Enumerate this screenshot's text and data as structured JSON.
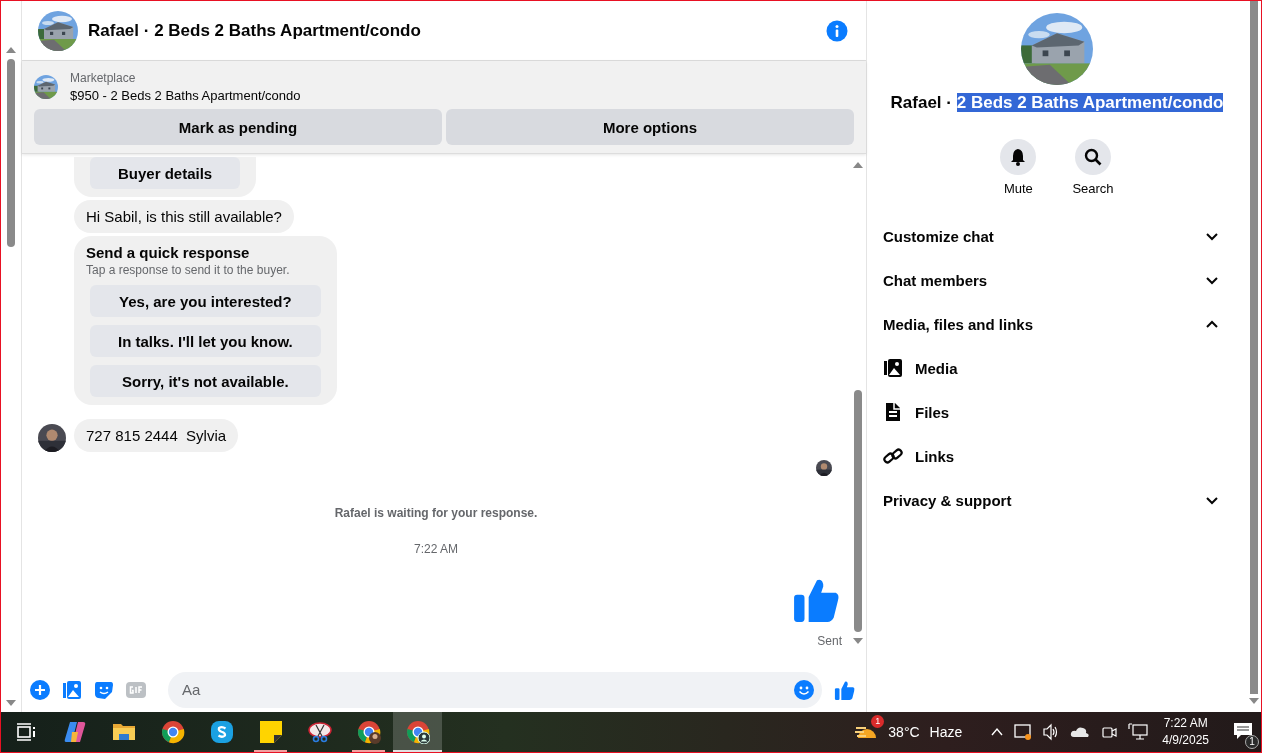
{
  "header": {
    "title": "Rafael · 2 Beds 2 Baths Apartment/condo"
  },
  "listing": {
    "label": "Marketplace",
    "title": "$950 - 2 Beds 2 Baths Apartment/condo",
    "buttons": [
      "Mark as pending",
      "More options"
    ]
  },
  "messages": [
    {
      "kind": "card",
      "buttons": [
        "Buyer details"
      ]
    },
    {
      "kind": "text",
      "text": "Hi Sabil, is this still available?"
    },
    {
      "kind": "quick_response",
      "title": "Send a quick response",
      "subtitle": "Tap a response to send it to the buyer.",
      "buttons": [
        "Yes, are you interested?",
        "In talks. I'll let you know.",
        "Sorry, it's not available."
      ]
    },
    {
      "kind": "text",
      "text": "727 815 2444  Sylvia"
    }
  ],
  "notice": "Rafael is waiting for your response.",
  "timestamp": "7:22 AM",
  "sent_status": "Sent",
  "composer": {
    "placeholder": "Aa"
  },
  "profile": {
    "title_parts": [
      {
        "text": "Rafael ·",
        "selected": false
      },
      {
        "text": "2 Beds 2 Baths Apartment/condo",
        "selected": true
      }
    ],
    "actions": [
      {
        "kind": "bell",
        "label": "Mute"
      },
      {
        "kind": "search",
        "label": "Search"
      }
    ],
    "sections": [
      {
        "label": "Customize chat",
        "expanded": false
      },
      {
        "label": "Chat members",
        "expanded": false
      },
      {
        "label": "Media, files and links",
        "expanded": true,
        "children": [
          {
            "kind": "media",
            "label": "Media"
          },
          {
            "kind": "file",
            "label": "Files"
          },
          {
            "kind": "link",
            "label": "Links"
          }
        ]
      },
      {
        "label": "Privacy & support",
        "expanded": false
      }
    ]
  },
  "taskbar": {
    "apps": [
      {
        "kind": "taskview",
        "running": false,
        "active": false
      },
      {
        "kind": "copilot",
        "running": false,
        "active": false
      },
      {
        "kind": "folder",
        "running": false,
        "active": false
      },
      {
        "kind": "chrome",
        "running": false,
        "active": false
      },
      {
        "kind": "skype",
        "running": false,
        "active": false
      },
      {
        "kind": "sticky",
        "running": true,
        "active": false
      },
      {
        "kind": "snip",
        "running": false,
        "active": false
      },
      {
        "kind": "chrome_avatar",
        "running": true,
        "active": false
      },
      {
        "kind": "chrome_profile",
        "running": true,
        "active": true
      }
    ],
    "weather_badge": "1",
    "temperature": "38°C",
    "condition": "Haze",
    "time": "7:22 AM",
    "date": "4/9/2025",
    "notification_count": "1"
  }
}
